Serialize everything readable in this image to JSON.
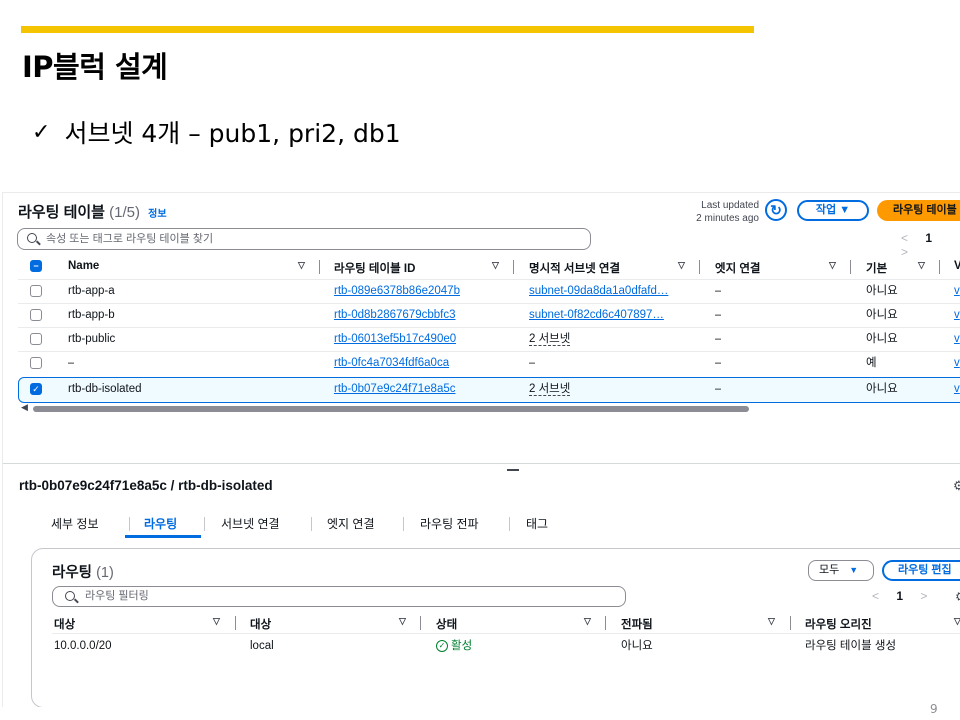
{
  "slide": {
    "title": "IP블럭 설계",
    "bullet_check": "✓",
    "bullet_text": "서브넷 4개 – pub1, pri2, db1",
    "page_number": "9"
  },
  "route_tables": {
    "title": "라우팅 테이블",
    "count": "(1/5)",
    "info_link": "정보",
    "last_updated_line1": "Last updated",
    "last_updated_line2": "2 minutes ago",
    "actions_label": "작업 ▼",
    "create_label": "라우팅 테이블 생성",
    "search_placeholder": "속성 또는 태그로 라우팅 테이블 찾기",
    "pager": {
      "prev": "<",
      "page": "1",
      "next": ">"
    },
    "columns": [
      "Name",
      "라우팅 테이블 ID",
      "명시적 서브넷 연결",
      "엣지 연결",
      "기본",
      "V"
    ],
    "rows": [
      {
        "name": "rtb-app-a",
        "id": "rtb-089e6378b86e2047b",
        "subnet": "subnet-09da8da1a0dfafd…",
        "edge": "–",
        "main": "아니요",
        "vpc": "v",
        "selected": false
      },
      {
        "name": "rtb-app-b",
        "id": "rtb-0d8b2867679cbbfc3",
        "subnet": "subnet-0f82cd6c407897…",
        "edge": "–",
        "main": "아니요",
        "vpc": "v",
        "selected": false
      },
      {
        "name": "rtb-public",
        "id": "rtb-06013ef5b17c490e0",
        "subnet": "2 서브넷",
        "edge": "–",
        "main": "아니요",
        "vpc": "v",
        "selected": false
      },
      {
        "name": "–",
        "id": "rtb-0fc4a7034fdf6a0ca",
        "subnet": "–",
        "edge": "–",
        "main": "예",
        "vpc": "v",
        "selected": false
      },
      {
        "name": "rtb-db-isolated",
        "id": "rtb-0b07e9c24f71e8a5c",
        "subnet": "2 서브넷",
        "edge": "–",
        "main": "아니요",
        "vpc": "v",
        "selected": true
      }
    ]
  },
  "detail": {
    "title": "rtb-0b07e9c24f71e8a5c / rtb-db-isolated",
    "tabs": [
      "세부 정보",
      "라우팅",
      "서브넷 연결",
      "엣지 연결",
      "라우팅 전파",
      "태그"
    ],
    "active_tab": "라우팅"
  },
  "routes": {
    "title": "라우팅",
    "count": "(1)",
    "filter_all": "모두",
    "edit_label": "라우팅 편집",
    "search_placeholder": "라우팅 필터링",
    "pager": {
      "prev": "<",
      "page": "1",
      "next": ">"
    },
    "columns": [
      "대상",
      "대상",
      "상태",
      "전파됨",
      "라우팅 오리진"
    ],
    "rows": [
      {
        "destination": "10.0.0.0/20",
        "target": "local",
        "status": "활성",
        "propagated": "아니요",
        "origin": "라우팅 테이블 생성"
      }
    ]
  },
  "colors": {
    "accent": "#f5c400",
    "link": "#006ce0",
    "primary_button": "#ff9900",
    "active_status": "#00802f"
  }
}
